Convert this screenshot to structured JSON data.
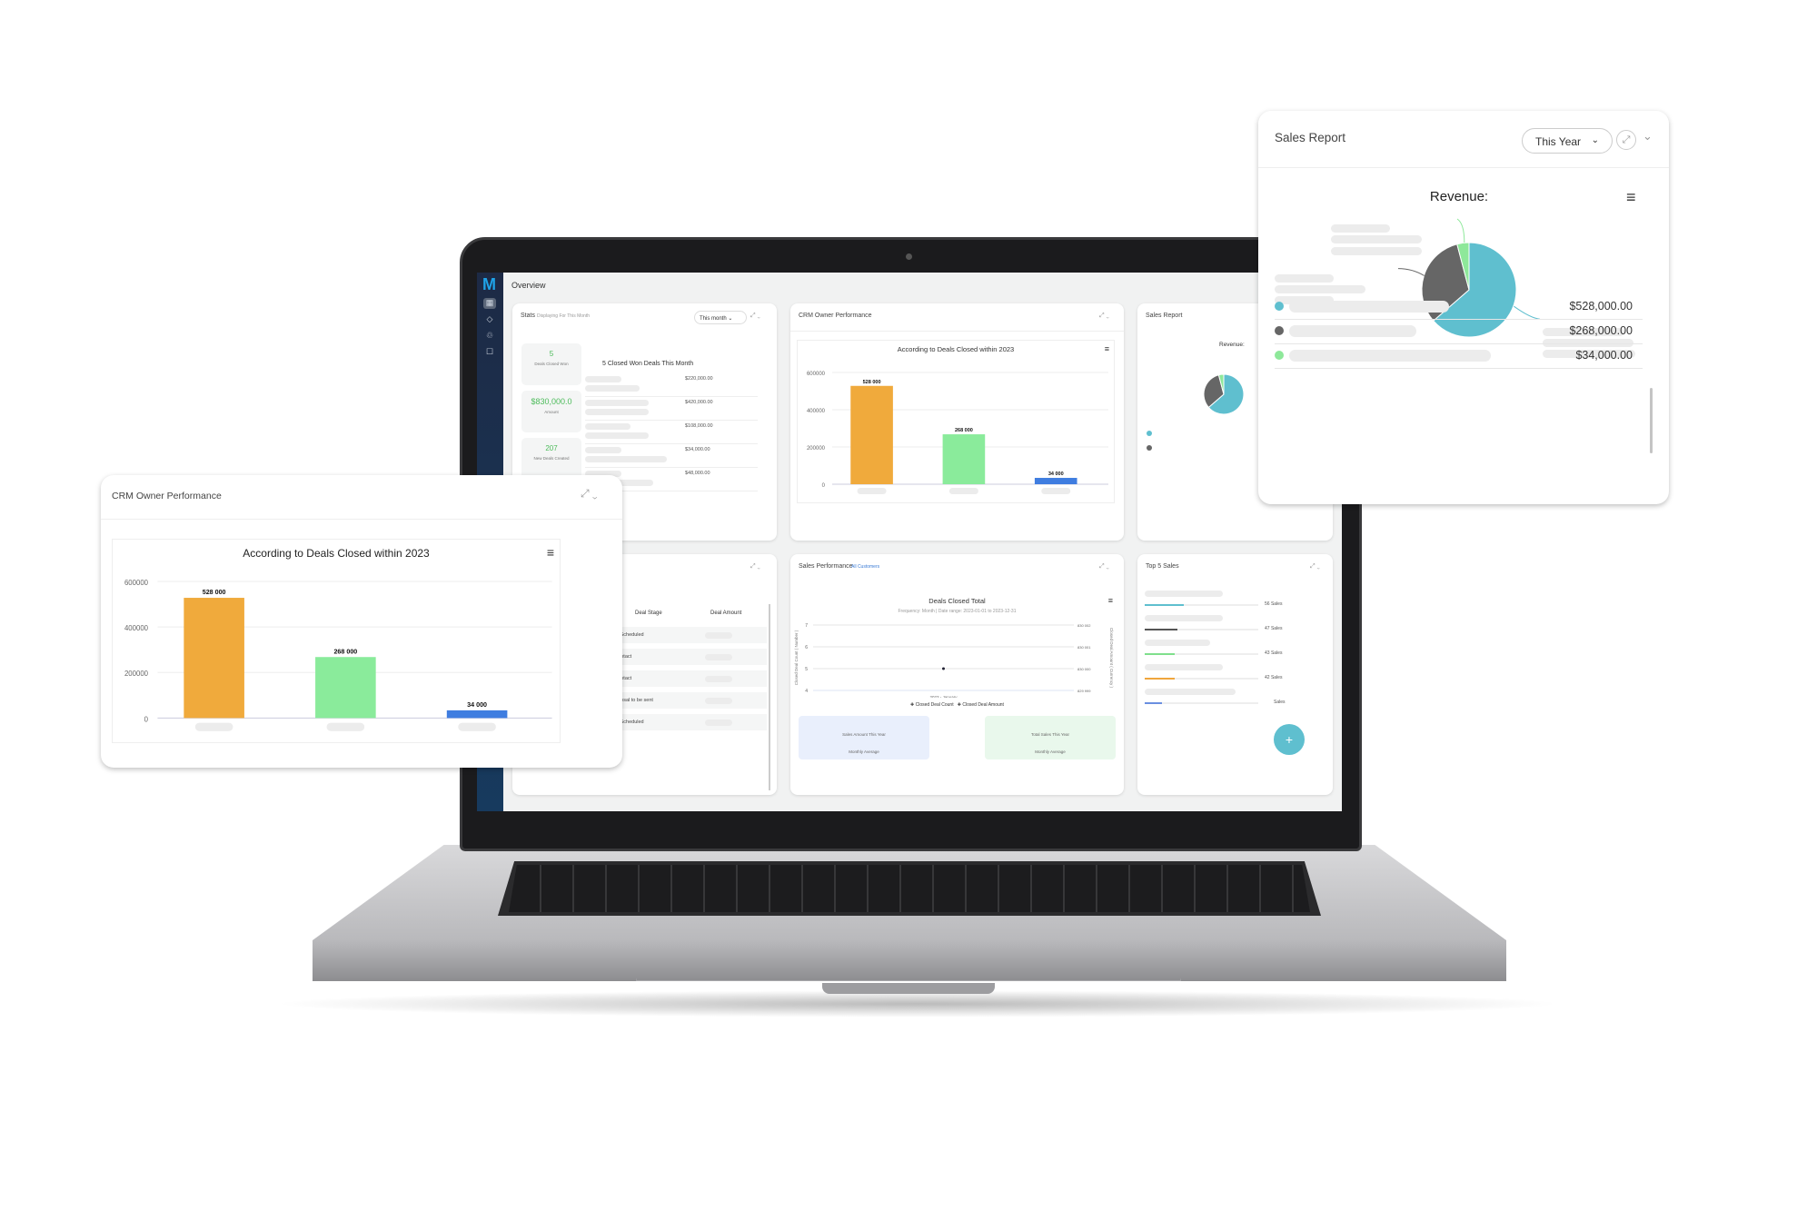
{
  "overview": {
    "title": "Overview",
    "logo": "M",
    "sidebar_icons": [
      "dashboard-icon",
      "tag-icon",
      "handshake-icon",
      "contact-icon"
    ]
  },
  "stats": {
    "title": "Stats",
    "subtitle": "Displaying For This Month",
    "dropdown": "This month",
    "kpis": [
      {
        "value": "5",
        "label": "Deals Closed Won"
      },
      {
        "value": "$830,000.0",
        "label": "Amount"
      },
      {
        "value": "207",
        "label": "New Deals Created"
      }
    ],
    "list_title": "5 Closed Won Deals This Month",
    "amounts": [
      "$220,000.00",
      "$420,000.00",
      "$108,000.00",
      "$34,000.00",
      "$48,000.00"
    ]
  },
  "crm": {
    "title": "CRM Owner Performance",
    "chart_title": "According to Deals Closed within 2023"
  },
  "sales_report_small": {
    "title": "Sales Report",
    "chart_title": "Revenue:"
  },
  "deals_table": {
    "headers": [
      "Deal Stage",
      "Deal Amount"
    ],
    "stages": [
      "ointment Scheduled",
      "First Contact",
      "First Contact",
      "g for Proposal to be sent",
      "ointment Scheduled"
    ]
  },
  "sales_performance": {
    "title": "Sales Performance",
    "link": "All Customers",
    "chart_title": "Deals Closed Total",
    "subtitle": "Frequency: Month | Date range: 2023-01-01 to 2023-12-31",
    "legend": [
      "Closed Deal Count",
      "Closed Deal Amount"
    ],
    "summary": [
      {
        "label": "Sales Amount This Year",
        "sub": "Monthly Average"
      },
      {
        "label": "Total Sales This Year",
        "sub": "Monthly Average"
      }
    ]
  },
  "top5": {
    "title": "Top 5 Sales",
    "items": [
      {
        "label": "56 Sales",
        "fraction": 0.34,
        "color": "#5fbfcf"
      },
      {
        "label": "47 Sales",
        "fraction": 0.29,
        "color": "#555555"
      },
      {
        "label": "43 Sales",
        "fraction": 0.26,
        "color": "#7fdf8c"
      },
      {
        "label": "42 Sales",
        "fraction": 0.26,
        "color": "#f0a63c"
      },
      {
        "label": "Sales",
        "fraction": 0.15,
        "color": "#6a8fe0"
      }
    ],
    "fab": "+"
  },
  "float_crm": {
    "title": "CRM Owner Performance"
  },
  "float_sales": {
    "title": "Sales Report",
    "dropdown": "This Year",
    "legend_values": [
      "$528,000.00",
      "$268,000.00",
      "$34,000.00"
    ]
  },
  "chart_data": [
    {
      "type": "bar",
      "title": "According to Deals Closed within 2023",
      "values": [
        528000,
        268000,
        34000
      ],
      "value_labels": [
        "528 000",
        "268 000",
        "34 000"
      ],
      "colors": [
        "#f0aa3c",
        "#8aeb9b",
        "#3f7de0"
      ],
      "ylim": [
        0,
        600000
      ],
      "yticks": [
        "0",
        "200000",
        "400000",
        "600000"
      ],
      "grid": true
    },
    {
      "type": "pie",
      "title": "Revenue:",
      "values": [
        528000,
        268000,
        34000
      ],
      "colors": [
        "#5fbfcf",
        "#666666",
        "#8ee89a"
      ]
    },
    {
      "type": "line",
      "title": "Deals Closed Total",
      "x": [
        "2023 - January"
      ],
      "series": [
        {
          "name": "Closed Deal Count",
          "values": [
            5
          ]
        },
        {
          "name": "Closed Deal Amount",
          "values": [
            830000
          ]
        }
      ],
      "yleft_ticks": [
        "4",
        "5",
        "6",
        "7"
      ],
      "yright_ticks": [
        "829 999",
        "830 000",
        "830 001",
        "830 002"
      ],
      "ylabel_left": "Closed Deal Count ( Number )",
      "ylabel_right": "Closed Deal Amount ( Currency )"
    }
  ]
}
